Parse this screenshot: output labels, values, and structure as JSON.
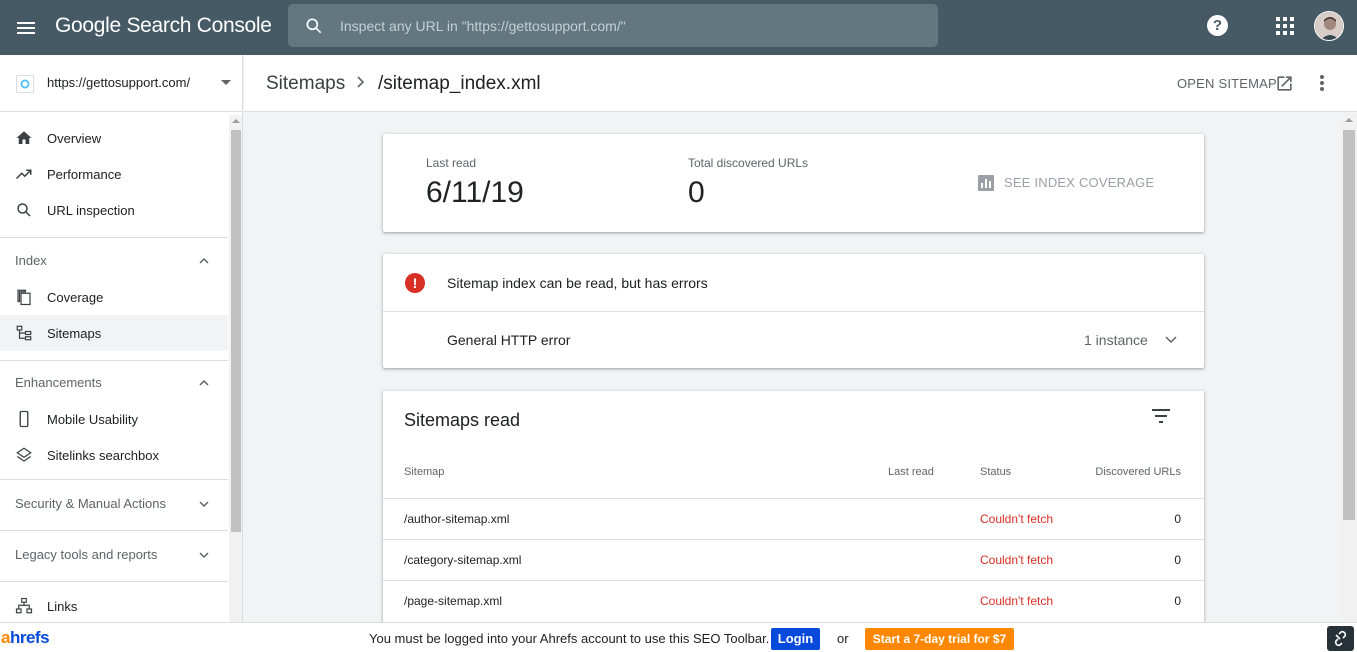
{
  "app": {
    "title": "Google Search Console",
    "search_placeholder": "Inspect any URL in \"https://gettosupport.com/\""
  },
  "property": {
    "url": "https://gettosupport.com/"
  },
  "sidebar": {
    "items": [
      {
        "label": "Overview"
      },
      {
        "label": "Performance"
      },
      {
        "label": "URL inspection"
      }
    ],
    "sections": [
      {
        "label": "Index",
        "items": [
          {
            "label": "Coverage"
          },
          {
            "label": "Sitemaps"
          }
        ]
      },
      {
        "label": "Enhancements",
        "items": [
          {
            "label": "Mobile Usability"
          },
          {
            "label": "Sitelinks searchbox"
          }
        ]
      },
      {
        "label": "Security & Manual Actions"
      },
      {
        "label": "Legacy tools and reports"
      }
    ],
    "links_label": "Links"
  },
  "header": {
    "crumb_root": "Sitemaps",
    "crumb_current": "/sitemap_index.xml",
    "open_sitemap": "OPEN SITEMAP"
  },
  "summary": {
    "last_read_label": "Last read",
    "last_read_value": "6/11/19",
    "discovered_label": "Total discovered URLs",
    "discovered_value": "0",
    "see_coverage": "SEE INDEX COVERAGE"
  },
  "errors": {
    "message": "Sitemap index can be read, but has errors",
    "type": "General HTTP error",
    "count": "1 instance"
  },
  "table": {
    "title": "Sitemaps read",
    "headers": {
      "sitemap": "Sitemap",
      "last_read": "Last read",
      "status": "Status",
      "urls": "Discovered URLs"
    },
    "rows": [
      {
        "sitemap": "/author-sitemap.xml",
        "last_read": "",
        "status": "Couldn't fetch",
        "urls": "0"
      },
      {
        "sitemap": "/category-sitemap.xml",
        "last_read": "",
        "status": "Couldn't fetch",
        "urls": "0"
      },
      {
        "sitemap": "/page-sitemap.xml",
        "last_read": "",
        "status": "Couldn't fetch",
        "urls": "0"
      }
    ]
  },
  "ahrefs": {
    "logo_a": "a",
    "logo_rest": "hrefs",
    "message": "You must be logged into your Ahrefs account to use this SEO Toolbar.",
    "login": "Login",
    "or": "or",
    "trial": "Start a 7-day trial for $7"
  },
  "colors": {
    "topbar": "#455a64",
    "error": "#d93025",
    "ahrefs_blue": "#054ada",
    "ahrefs_orange": "#ff8800"
  }
}
